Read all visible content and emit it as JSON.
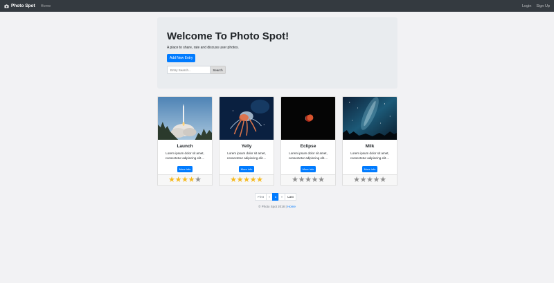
{
  "navbar": {
    "brand": "Photo Spot",
    "home": "Home",
    "login": "Login",
    "signup": "Sign Up"
  },
  "jumbotron": {
    "title": "Welcome To Photo Spot!",
    "lead": "A place to share, rate and discuss user photos.",
    "add_button": "Add New Entry",
    "search_placeholder": "Entry Search...",
    "search_button": "Search"
  },
  "cards": [
    {
      "title": "Launch",
      "text": "Lorem ipsum dolor sit amet, consectetur adipiscing elit....",
      "button": "More info",
      "rating": 4
    },
    {
      "title": "Yelly",
      "text": "Lorem ipsum dolor sit amet, consectetur adipiscing elit....",
      "button": "More info",
      "rating": 5
    },
    {
      "title": "Eclipse",
      "text": "Lorem ipsum dolor sit amet, consectetur adipiscing elit....",
      "button": "More info",
      "rating": 0
    },
    {
      "title": "Milk",
      "text": "Lorem ipsum dolor sit amet, consectetur adipiscing elit....",
      "button": "More info",
      "rating": 0
    }
  ],
  "pagination": {
    "first": "First",
    "prev": "«",
    "current": "1",
    "next": "»",
    "last": "Last"
  },
  "footer": {
    "text": "© Photo Spot 2018 |",
    "link": "Home"
  },
  "colors": {
    "navbar": "#343a40",
    "primary": "#007bff",
    "star_on": "#f5b91e",
    "star_off": "#8e8e8e"
  }
}
